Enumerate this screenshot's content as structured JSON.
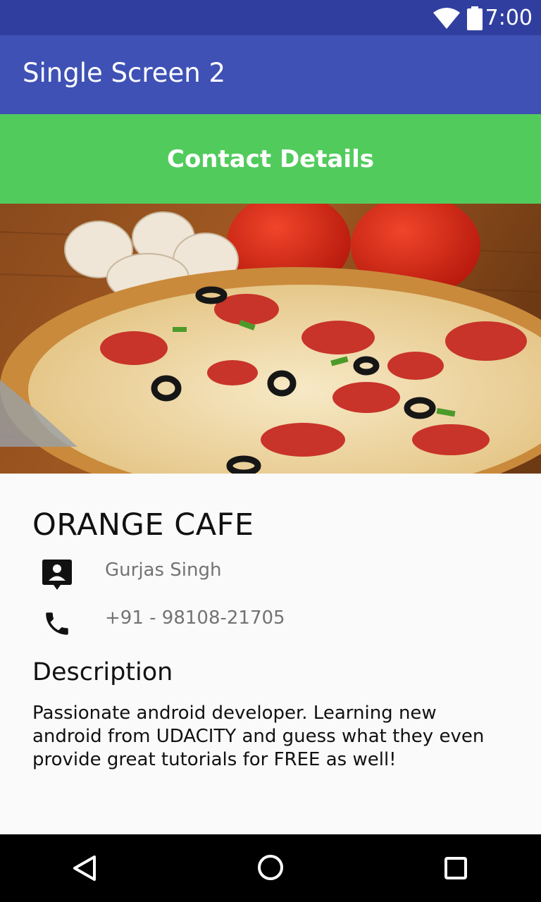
{
  "status_bar": {
    "time": "7:00",
    "icons": [
      "wifi-icon",
      "battery-icon"
    ]
  },
  "app_bar": {
    "title": "Single Screen 2"
  },
  "contact_button": {
    "label": "Contact Details"
  },
  "hero_image": {
    "subject": "pizza-photo"
  },
  "cafe": {
    "name": "ORANGE CAFE",
    "person_icon": "contact-person-icon",
    "person_name": "Gurjas Singh",
    "phone_icon": "phone-icon",
    "phone": "+91 - 98108-21705"
  },
  "description": {
    "heading": "Description",
    "text": "Passionate android developer. Learning new android from UDACITY and guess what they even provide great tutorials for FREE as well!"
  },
  "nav_bar": {
    "icons": [
      "back-icon",
      "home-icon",
      "recents-icon"
    ]
  },
  "colors": {
    "status_bar": "#303f9f",
    "app_bar": "#3f51b5",
    "contact_button": "#52cb5d",
    "background": "#fafafa"
  }
}
